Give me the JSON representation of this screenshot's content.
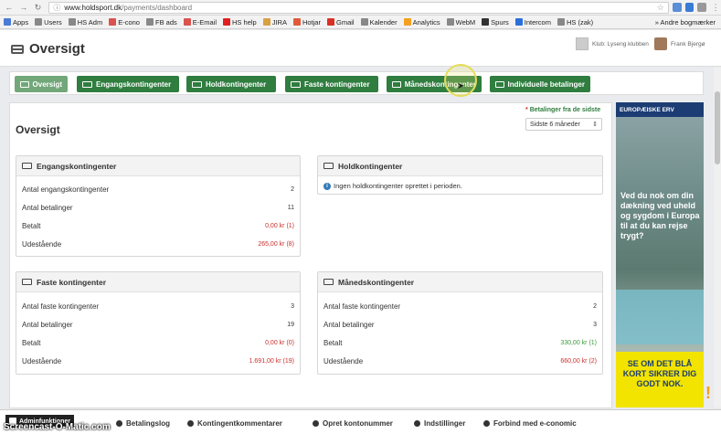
{
  "browser": {
    "url_host": "www.holdsport.dk",
    "url_path": "/payments/dashboard",
    "bookmarks": [
      "Apps",
      "Users",
      "HS Adm",
      "E-cono",
      "FB ads",
      "E-Email",
      "HS help",
      "JIRA",
      "Hotjar",
      "Gmail",
      "Kalender",
      "Analytics",
      "WebM",
      "Spurs",
      "Intercom",
      "HS (zak)"
    ],
    "bookmarks_more": "Andre bogmærker"
  },
  "header": {
    "title": "Oversigt",
    "club": "Klub: Lyseng klubben",
    "user": "Frank Bjergø"
  },
  "tabs": [
    {
      "label": "Oversigt",
      "active": true
    },
    {
      "label": "Engangskontingenter",
      "active": false
    },
    {
      "label": "Holdkontingenter",
      "active": false
    },
    {
      "label": "Faste kontingenter",
      "active": false
    },
    {
      "label": "Månedskontingenter",
      "active": false
    },
    {
      "label": "Individuelle betalinger",
      "active": false
    }
  ],
  "main": {
    "title": "Oversigt",
    "filter_label": "Betalinger fra de sidste",
    "filter_required_mark": "*",
    "filter_value": "Sidste 6 måneder"
  },
  "panels": {
    "engang": {
      "title": "Engangskontingenter",
      "rows": [
        {
          "label": "Antal engangskontingenter",
          "value": "2",
          "tone": "normal"
        },
        {
          "label": "Antal betalinger",
          "value": "11",
          "tone": "normal"
        },
        {
          "label": "Betalt",
          "value": "0,00 kr (1)",
          "tone": "red"
        },
        {
          "label": "Udestående",
          "value": "265,00 kr (8)",
          "tone": "red"
        }
      ]
    },
    "hold": {
      "title": "Holdkontingenter",
      "info": "Ingen holdkontingenter oprettet i perioden."
    },
    "faste": {
      "title": "Faste kontingenter",
      "rows": [
        {
          "label": "Antal faste kontingenter",
          "value": "3",
          "tone": "normal"
        },
        {
          "label": "Antal betalinger",
          "value": "19",
          "tone": "normal"
        },
        {
          "label": "Betalt",
          "value": "0,00 kr (0)",
          "tone": "red"
        },
        {
          "label": "Udestående",
          "value": "1.691,00 kr (19)",
          "tone": "red"
        }
      ]
    },
    "maaned": {
      "title": "Månedskontingenter",
      "rows": [
        {
          "label": "Antal faste kontingenter",
          "value": "2",
          "tone": "normal"
        },
        {
          "label": "Antal betalinger",
          "value": "3",
          "tone": "normal"
        },
        {
          "label": "Betalt",
          "value": "330,00 kr (1)",
          "tone": "green"
        },
        {
          "label": "Udestående",
          "value": "660,00 kr (2)",
          "tone": "red"
        }
      ]
    }
  },
  "ad": {
    "brand": "EUROPÆISKE ERV",
    "headline": "Ved du nok om din dækning ved uheld og sygdom i Europa til at du kan rejse trygt?",
    "footer": "SE OM DET BLÅ KORT SIKRER DIG GODT NOK."
  },
  "bottombar": {
    "admin": "Adminfunktioner",
    "items": [
      "Betalingslog",
      "Kontingentkommentarer",
      "Opret kontonummer",
      "Indstillinger",
      "Forbind med e-conomic"
    ]
  },
  "watermark": "Screencast-O-Matic.com",
  "colors": {
    "tab_green": "#2f7d3f",
    "tab_active": "#72a77a",
    "red": "#c9302c",
    "green": "#3c9a3c"
  }
}
